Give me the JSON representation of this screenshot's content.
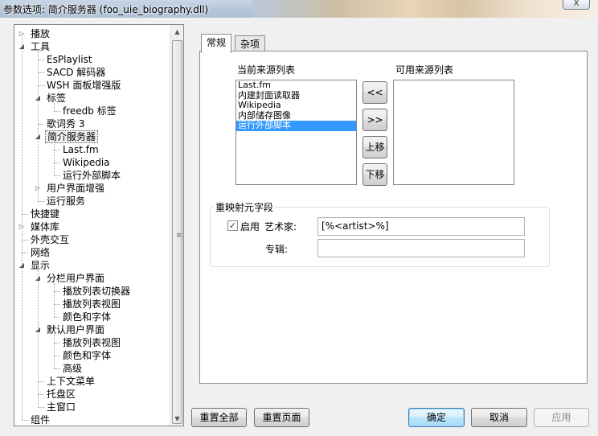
{
  "window": {
    "title": "参数选项: 简介服务器 (foo_uie_biography.dll)",
    "close_glyph": "X"
  },
  "tree": {
    "items": [
      {
        "label": "播放",
        "level": 0,
        "expander": "▷"
      },
      {
        "label": "工具",
        "level": 0,
        "expander": "◢"
      },
      {
        "label": "EsPlaylist",
        "level": 1,
        "expander": ""
      },
      {
        "label": "SACD 解码器",
        "level": 1,
        "expander": ""
      },
      {
        "label": "WSH 面板增强版",
        "level": 1,
        "expander": ""
      },
      {
        "label": "标签",
        "level": 1,
        "expander": "◢"
      },
      {
        "label": "freedb 标签",
        "level": 2,
        "expander": ""
      },
      {
        "label": "歌词秀 3",
        "level": 1,
        "expander": ""
      },
      {
        "label": "简介服务器",
        "level": 1,
        "expander": "◢",
        "selected": true
      },
      {
        "label": "Last.fm",
        "level": 2,
        "expander": ""
      },
      {
        "label": "Wikipedia",
        "level": 2,
        "expander": ""
      },
      {
        "label": "运行外部脚本",
        "level": 2,
        "expander": ""
      },
      {
        "label": "用户界面增强",
        "level": 1,
        "expander": "▷"
      },
      {
        "label": "运行服务",
        "level": 1,
        "expander": ""
      },
      {
        "label": "快捷键",
        "level": 0,
        "expander": ""
      },
      {
        "label": "媒体库",
        "level": 0,
        "expander": "▷"
      },
      {
        "label": "外壳交互",
        "level": 0,
        "expander": ""
      },
      {
        "label": "网络",
        "level": 0,
        "expander": ""
      },
      {
        "label": "显示",
        "level": 0,
        "expander": "◢"
      },
      {
        "label": "分栏用户界面",
        "level": 1,
        "expander": "◢"
      },
      {
        "label": "播放列表切换器",
        "level": 2,
        "expander": ""
      },
      {
        "label": "播放列表视图",
        "level": 2,
        "expander": ""
      },
      {
        "label": "颜色和字体",
        "level": 2,
        "expander": ""
      },
      {
        "label": "默认用户界面",
        "level": 1,
        "expander": "◢"
      },
      {
        "label": "播放列表视图",
        "level": 2,
        "expander": ""
      },
      {
        "label": "颜色和字体",
        "level": 2,
        "expander": ""
      },
      {
        "label": "高级",
        "level": 2,
        "expander": ""
      },
      {
        "label": "上下文菜单",
        "level": 1,
        "expander": ""
      },
      {
        "label": "托盘区",
        "level": 1,
        "expander": ""
      },
      {
        "label": "主窗口",
        "level": 1,
        "expander": ""
      },
      {
        "label": "组件",
        "level": 0,
        "expander": ""
      }
    ],
    "scroll_up_glyph": "▲",
    "scroll_down_glyph": "▼",
    "scroll_grip_glyph": "≡"
  },
  "tabs": [
    {
      "label": "常规",
      "active": true
    },
    {
      "label": "杂项",
      "active": false
    }
  ],
  "general": {
    "current_sources_label": "当前来源列表",
    "available_sources_label": "可用来源列表",
    "current_sources": [
      "Last.fm",
      "内建封面读取器",
      "Wikipedia",
      "内部储存图像",
      "运行外部脚本"
    ],
    "selected_source_index": 4,
    "available_sources": [],
    "move_left_label": "<<",
    "move_right_label": ">>",
    "move_up_label": "上移",
    "move_down_label": "下移",
    "remap_group_title": "重映射元字段",
    "enable_checkbox_checked": true,
    "enable_label": "启用",
    "artist_label": "艺术家:",
    "artist_value": "[%<artist>%]",
    "album_label": "专辑:",
    "album_value": ""
  },
  "footer": {
    "reset_all": "重置全部",
    "reset_page": "重置页面",
    "ok": "确定",
    "cancel": "取消",
    "apply": "应用"
  },
  "colors": {
    "selection": "#3399ff",
    "default_button_border": "#3c7fb1"
  }
}
